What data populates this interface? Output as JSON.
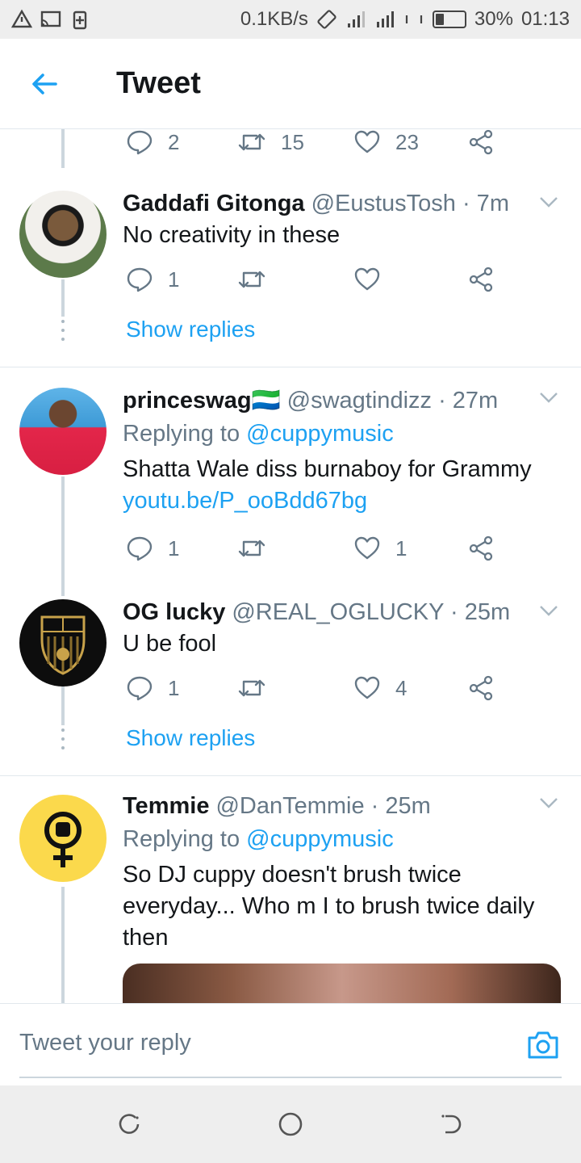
{
  "status_bar": {
    "speed": "0.1KB/s",
    "battery": "30%",
    "time": "01:13",
    "battery_level": 0.3
  },
  "header": {
    "title": "Tweet"
  },
  "top_actions": {
    "replies": "2",
    "retweets": "15",
    "likes": "23"
  },
  "tweets": [
    {
      "name": "Gaddafi Gitonga",
      "handle": "@EustusTosh · 7m",
      "text": "No creativity in these",
      "replies": "1",
      "retweets": "",
      "likes": "",
      "show_replies": "Show replies"
    },
    {
      "name": "princeswag",
      "flag": "🇸🇱",
      "handle": "@swagtindizz · 27m",
      "replying_prefix": "Replying to",
      "replying_to": "@cuppymusic",
      "text": "Shatta Wale diss burnaboy for Grammy",
      "link": "youtu.be/P_ooBdd67bg",
      "replies": "1",
      "retweets": "",
      "likes": "1"
    },
    {
      "name": "OG lucky",
      "handle": "@REAL_OGLUCKY · 25m",
      "text": "U be fool",
      "replies": "1",
      "retweets": "",
      "likes": "4",
      "show_replies": "Show replies"
    },
    {
      "name": "Temmie",
      "handle": "@DanTemmie · 25m",
      "replying_prefix": "Replying to",
      "replying_to": "@cuppymusic",
      "text_lines": [
        "So DJ cuppy doesn't brush twice",
        "everyday... Who m I to brush twice daily",
        "then"
      ]
    }
  ],
  "reply_bar": {
    "placeholder": "Tweet your reply"
  },
  "colors": {
    "accent": "#1da1f2",
    "secondary_text": "#657786",
    "divider": "#e1e8ed"
  }
}
